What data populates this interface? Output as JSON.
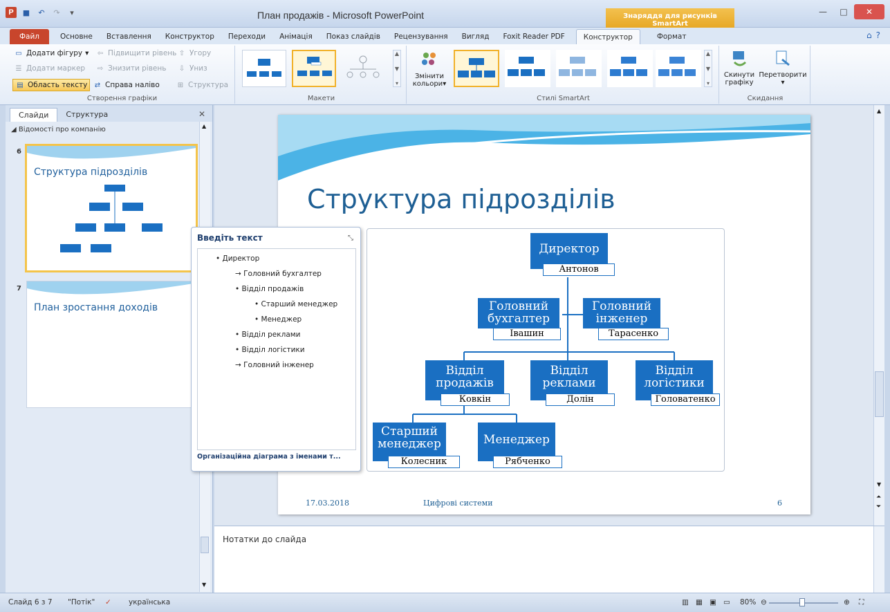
{
  "window": {
    "title": "План продажів - Microsoft PowerPoint",
    "context_tab_header": "Знаряддя для рисунків SmartArt"
  },
  "ribbon_tabs": [
    "Файл",
    "Основне",
    "Вставлення",
    "Конструктор",
    "Переходи",
    "Анімація",
    "Показ слайдів",
    "Рецензування",
    "Вигляд",
    "Foxit Reader PDF",
    "Конструктор",
    "Формат"
  ],
  "ribbon": {
    "create_graphic": {
      "add_shape": "Додати фігуру",
      "promote": "Підвищити рівень",
      "move_up": "Угору",
      "add_bullet": "Додати маркер",
      "demote": "Знизити рівень",
      "move_down": "Униз",
      "text_pane": "Область тексту",
      "right_to_left": "Справа наліво",
      "layout": "Структура",
      "label": "Створення графіки"
    },
    "layouts_label": "Макети",
    "change_colors_1": "Змінити",
    "change_colors_2": "кольори",
    "styles_label": "Стилі SmartArt",
    "reset_graphic_1": "Скинути",
    "reset_graphic_2": "графіку",
    "convert": "Перетворити",
    "reset_label": "Скидання"
  },
  "left_panel": {
    "tab_slides": "Слайди",
    "tab_outline": "Структура",
    "section": "Відомості про компанію",
    "slides": [
      {
        "num": "6",
        "title": "Структура підрозділів"
      },
      {
        "num": "7",
        "title": "План зростання доходів"
      }
    ]
  },
  "slide": {
    "title": "Структура підрозділів",
    "footer_date": "17.03.2018",
    "footer_center": "Цифрові системи",
    "footer_num": "6"
  },
  "org_chart": {
    "director": {
      "title": "Директор",
      "name": "Антонов"
    },
    "accountant": {
      "title1": "Головний",
      "title2": "бухгалтер",
      "name": "Івашин"
    },
    "engineer": {
      "title1": "Головний",
      "title2": "інженер",
      "name": "Тарасенко"
    },
    "sales": {
      "title1": "Відділ",
      "title2": "продажів",
      "name": "Ковкін"
    },
    "ads": {
      "title1": "Відділ",
      "title2": "реклами",
      "name": "Долін"
    },
    "logistics": {
      "title1": "Відділ",
      "title2": "логістики",
      "name": "Головатенко"
    },
    "senior_manager": {
      "title1": "Старший",
      "title2": "менеджер",
      "name": "Колесник"
    },
    "manager": {
      "title": "Менеджер",
      "name": "Рябченко"
    }
  },
  "text_pane": {
    "title": "Введіть текст",
    "items": [
      "Директор",
      "Головний бухгалтер",
      "Відділ продажів",
      "Старший менеджер",
      "Менеджер",
      "Відділ реклами",
      "Відділ логістики",
      "Головний інженер"
    ],
    "footer": "Організаційна діаграма з іменами т..."
  },
  "notes_placeholder": "Нотатки до слайда",
  "status": {
    "slide_count": "Слайд 6 з 7",
    "theme": "\"Потік\"",
    "language": "українська",
    "zoom": "80%"
  },
  "colors": {
    "accent_blue": "#1a6fc2",
    "title_blue": "#1e5f94",
    "file_tab": "#c8452c"
  }
}
